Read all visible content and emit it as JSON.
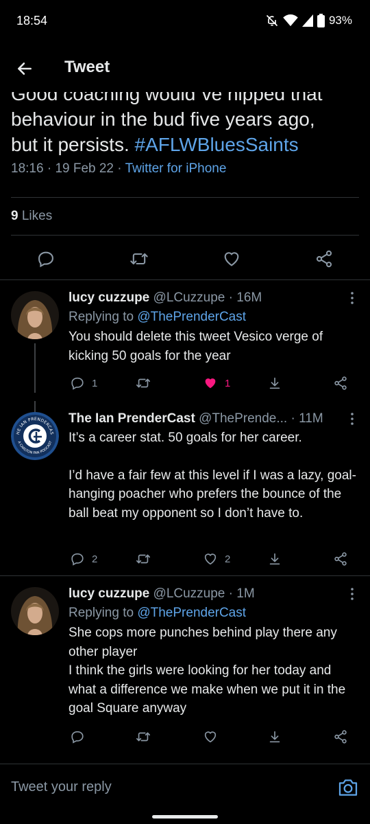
{
  "status_bar": {
    "time": "18:54",
    "battery": "93%",
    "icons": [
      "mute-bell-icon",
      "wifi-icon",
      "signal-icon",
      "battery-icon"
    ]
  },
  "header": {
    "title": "Tweet",
    "back_icon": "arrow-left-icon"
  },
  "main_tweet": {
    "text_line1": "Good coaching would´ve nipped that",
    "text_line2": "behaviour in the bud five years ago,",
    "text_line3_prefix": "but it persists. ",
    "hashtag": "#AFLWBluesSaints",
    "time": "18:16",
    "date": "19 Feb 22",
    "source": "Twitter for iPhone",
    "likes_count": "9",
    "likes_label": "Likes"
  },
  "replies": [
    {
      "name": "lucy cuzzupe",
      "handle": "@LCuzzupe",
      "age": "16M",
      "replying_prefix": "Replying to",
      "replying_to": "@ThePrenderCast",
      "text": "You should delete this tweet Vesico  verge of kicking 50 goals for the year",
      "reply_count": "1",
      "like_count": "1",
      "liked": true
    },
    {
      "name": "The Ian PrenderCast",
      "handle": "@ThePrende...",
      "age": "11M",
      "text_p1": "It’s a career stat. 50 goals for her career.",
      "text_p2": "I’d have a fair few at this level if I was a lazy, goal-hanging poacher who prefers the bounce of the ball beat my opponent so I don’t have to.",
      "reply_count": "2",
      "like_count": "2",
      "liked": false,
      "avatar_ring_text_top": "THE IAN PRENDERCAST",
      "avatar_ring_text_bottom": "A CARLTON FAN PODCAST"
    },
    {
      "name": "lucy cuzzupe",
      "handle": "@LCuzzupe",
      "age": "1M",
      "replying_prefix": "Replying to",
      "replying_to": "@ThePrenderCast",
      "text": "She cops more punches behind play there any other player\nI think the girls were looking for her today and what a difference we make when we put it in the goal  Square anyway"
    }
  ],
  "compose": {
    "placeholder": "Tweet your reply",
    "camera_icon": "camera-icon"
  },
  "colors": {
    "background": "#000000",
    "accent": "#5ea4e8",
    "like": "#f91880",
    "muted": "#8b98a5",
    "text": "#e7e9ea"
  }
}
